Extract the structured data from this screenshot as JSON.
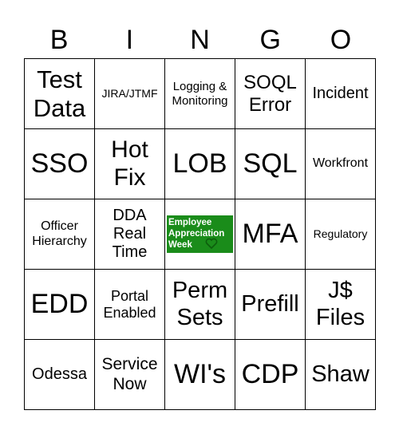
{
  "header": {
    "letters": [
      "B",
      "I",
      "N",
      "G",
      "O"
    ]
  },
  "cells": [
    [
      "Test Data",
      "JIRA/JTMF",
      "Logging & Monitoring",
      "SOQL Error",
      "Incident"
    ],
    [
      "SSO",
      "Hot Fix",
      "LOB",
      "SQL",
      "Workfront"
    ],
    [
      "Officer Hierarchy",
      "DDA Real Time",
      "Employee Appreciation Week",
      "MFA",
      "Regulatory"
    ],
    [
      "EDD",
      "Portal Enabled",
      "Perm Sets",
      "Prefill",
      "J$ Files"
    ],
    [
      "Odessa",
      "Service Now",
      "WI's",
      "CDP",
      "Shaw"
    ]
  ],
  "free_space": {
    "icon": "heart-icon",
    "color": "#1a8c1a"
  }
}
